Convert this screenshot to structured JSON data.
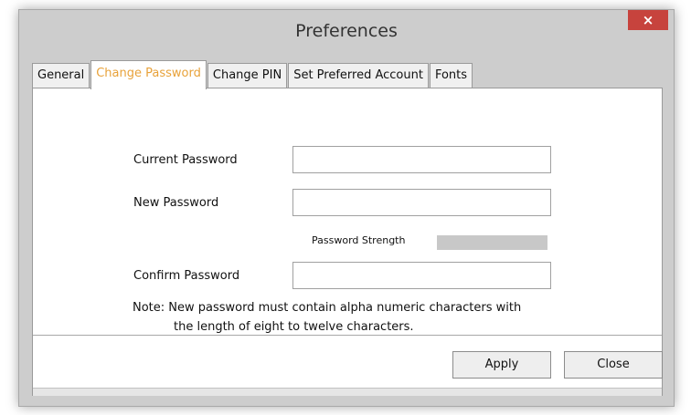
{
  "window": {
    "title": "Preferences",
    "close_label": "×"
  },
  "tabs": [
    {
      "label": "General",
      "active": false
    },
    {
      "label": "Change Password",
      "active": true
    },
    {
      "label": "Change PIN",
      "active": false
    },
    {
      "label": "Set Preferred Account",
      "active": false
    },
    {
      "label": "Fonts",
      "active": false
    }
  ],
  "form": {
    "current_password": {
      "label": "Current Password",
      "value": ""
    },
    "new_password": {
      "label": "New Password",
      "value": ""
    },
    "strength": {
      "label": "Password Strength",
      "level": 0
    },
    "confirm_password": {
      "label": "Confirm Password",
      "value": ""
    },
    "note_line1": "Note: New password must contain alpha numeric characters with",
    "note_line2": "the length of eight to twelve characters."
  },
  "buttons": {
    "apply": "Apply",
    "close": "Close"
  },
  "colors": {
    "active_tab_text": "#e8a23a",
    "close_button": "#c7433d"
  }
}
